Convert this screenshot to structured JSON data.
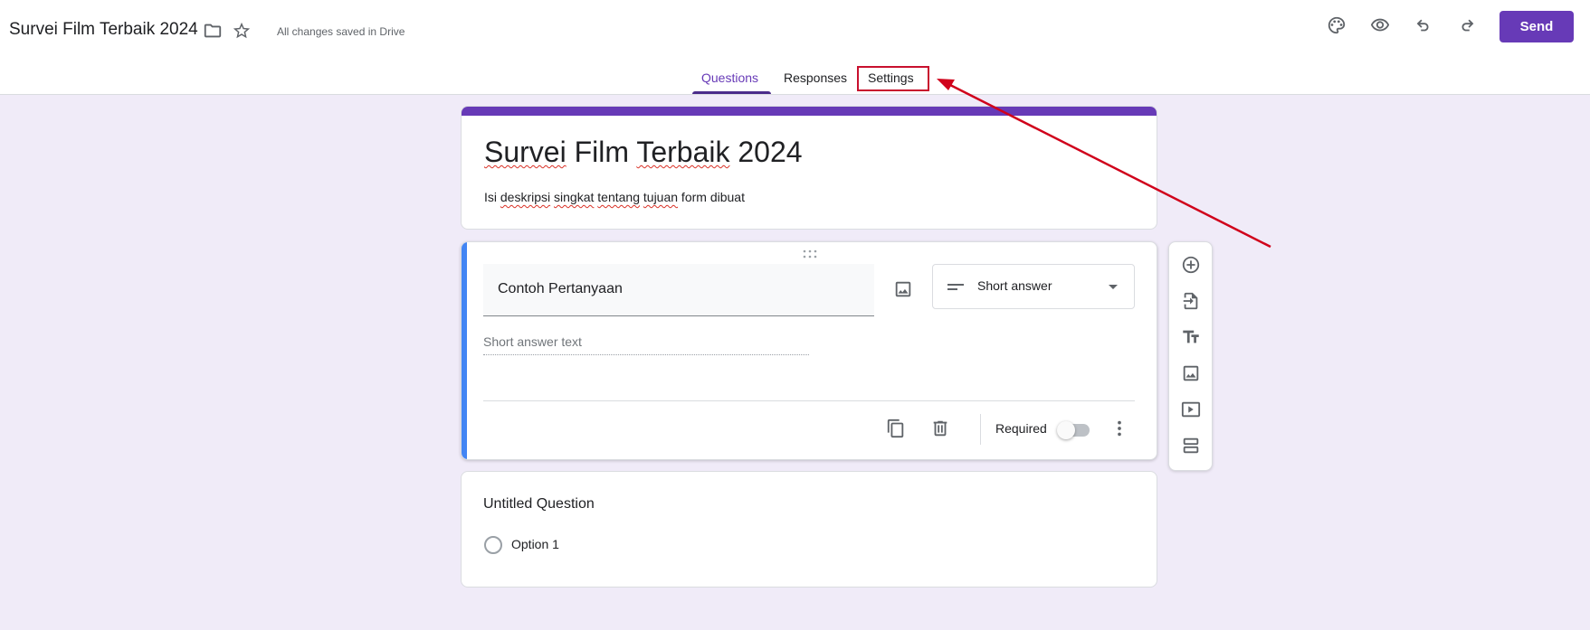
{
  "header": {
    "doc_title": "Survei Film Terbaik 2024",
    "saved_status": "All changes saved in Drive",
    "send_label": "Send",
    "icons": [
      "folder-icon",
      "star-icon",
      "palette-icon",
      "preview-eye-icon",
      "undo-icon",
      "redo-icon"
    ]
  },
  "tabs": [
    {
      "label": "Questions",
      "active": true
    },
    {
      "label": "Responses",
      "active": false
    },
    {
      "label": "Settings",
      "active": false,
      "highlighted": true
    }
  ],
  "form": {
    "title": "Survei Film Terbaik 2024",
    "title_words": [
      "Survei",
      " Film ",
      "Terbaik",
      " 2024"
    ],
    "description_parts": [
      "Isi ",
      "deskripsi",
      " ",
      "singkat",
      " ",
      "tentang",
      " ",
      "tujuan",
      " form dibuat"
    ]
  },
  "question_1": {
    "title": "Contoh Pertanyaan",
    "type": "Short answer",
    "answer_placeholder": "Short answer text",
    "required_label": "Required",
    "required": false
  },
  "question_2": {
    "title": "Untitled Question",
    "options": [
      "Option 1"
    ]
  },
  "side_toolbar": [
    "add-question-icon",
    "import-questions-icon",
    "add-title-icon",
    "add-image-icon",
    "add-video-icon",
    "add-section-icon"
  ],
  "colors": {
    "accent": "#673ab7",
    "active_question_bar": "#4285f4",
    "background": "#f0ebf8",
    "annotation": "#d0021b"
  }
}
